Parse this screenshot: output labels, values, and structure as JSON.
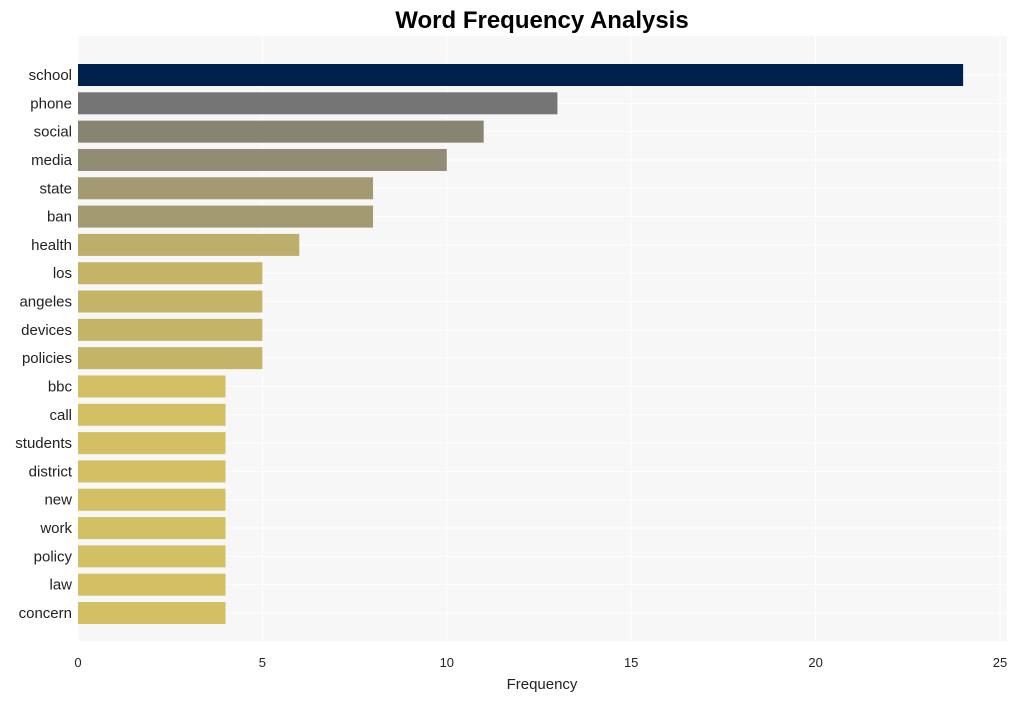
{
  "chart_data": {
    "type": "bar",
    "orientation": "horizontal",
    "title": "Word Frequency Analysis",
    "xlabel": "Frequency",
    "ylabel": "",
    "xlim": [
      0,
      25
    ],
    "xticks": [
      0,
      5,
      10,
      15,
      20,
      25
    ],
    "grid": true,
    "legend": "none",
    "categories": [
      "school",
      "phone",
      "social",
      "media",
      "state",
      "ban",
      "health",
      "los",
      "angeles",
      "devices",
      "policies",
      "bbc",
      "call",
      "students",
      "district",
      "new",
      "work",
      "policy",
      "law",
      "concern"
    ],
    "values": [
      24,
      13,
      11,
      10,
      8,
      8,
      6,
      5,
      5,
      5,
      5,
      4,
      4,
      4,
      4,
      4,
      4,
      4,
      4,
      4
    ],
    "colors": [
      "#00204e",
      "#757575",
      "#878472",
      "#928b76",
      "#a39a72",
      "#a39a72",
      "#bcaf6c",
      "#c4b467",
      "#c4b467",
      "#c4b467",
      "#c4b467",
      "#d3c064",
      "#d3c064",
      "#d3c064",
      "#d3c064",
      "#d3c064",
      "#d3c064",
      "#d3c064",
      "#d3c064",
      "#d3c064"
    ],
    "background": "#f7f7f7"
  }
}
